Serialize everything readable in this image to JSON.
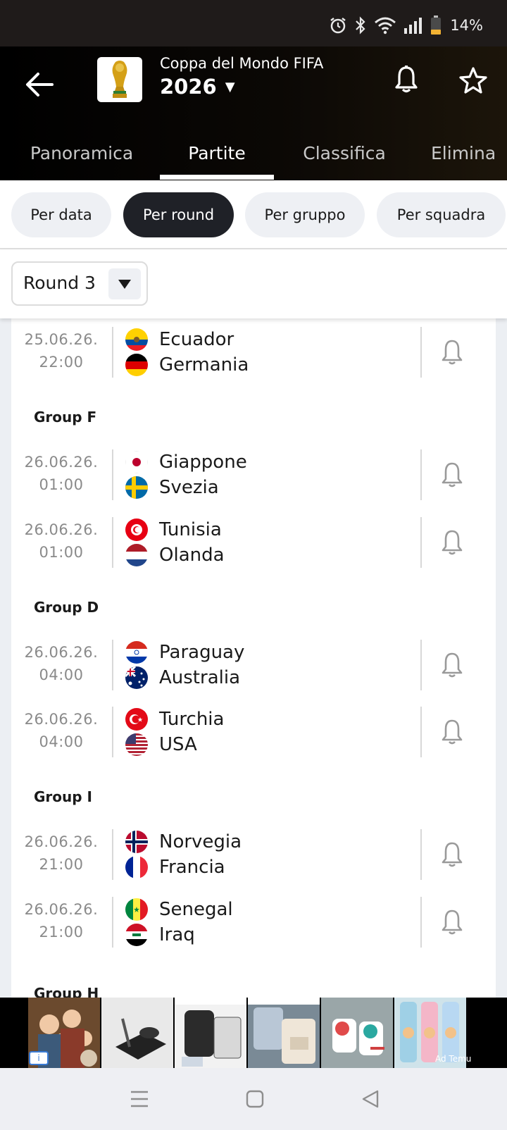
{
  "status_bar": {
    "battery_text": "14%",
    "icons": [
      "alarm-icon",
      "bluetooth-icon",
      "wifi-icon",
      "signal-icon",
      "battery-icon"
    ]
  },
  "header": {
    "competition": "Coppa del Mondo FIFA",
    "season": "2026",
    "season_caret": "▼",
    "icons": [
      "back-arrow-icon",
      "trophy-icon",
      "bell-icon",
      "star-icon"
    ]
  },
  "tabs": [
    {
      "label": "Panoramica",
      "active": false
    },
    {
      "label": "Partite",
      "active": true
    },
    {
      "label": "Classifica",
      "active": false
    },
    {
      "label": "Elimina",
      "active": false
    }
  ],
  "filters": [
    {
      "label": "Per data",
      "active": false
    },
    {
      "label": "Per round",
      "active": true
    },
    {
      "label": "Per gruppo",
      "active": false
    },
    {
      "label": "Per squadra",
      "active": false
    }
  ],
  "round_select": {
    "value": "Round 3",
    "arrow": "▼"
  },
  "matches": [
    {
      "date": "25.06.26.",
      "time": "22:00",
      "home": "Ecuador",
      "away": "Germania"
    },
    {
      "date": "26.06.26.",
      "time": "01:00",
      "home": "Giappone",
      "away": "Svezia"
    },
    {
      "date": "26.06.26.",
      "time": "01:00",
      "home": "Tunisia",
      "away": "Olanda"
    },
    {
      "date": "26.06.26.",
      "time": "04:00",
      "home": "Paraguay",
      "away": "Australia"
    },
    {
      "date": "26.06.26.",
      "time": "04:00",
      "home": "Turchia",
      "away": "USA"
    },
    {
      "date": "26.06.26.",
      "time": "21:00",
      "home": "Norvegia",
      "away": "Francia"
    },
    {
      "date": "26.06.26.",
      "time": "21:00",
      "home": "Senegal",
      "away": "Iraq"
    }
  ],
  "groups": [
    "Group F",
    "Group D",
    "Group I",
    "Group H"
  ],
  "ad": {
    "label": "Ad Temu",
    "info": "i"
  },
  "nav": {
    "icons": [
      "menu-icon",
      "home-square-icon",
      "back-triangle-icon"
    ]
  },
  "colors": {
    "header_bg": "#000000",
    "active_chip": "#1f2127",
    "chip_bg": "#eef0f4",
    "list_bg": "#eceff3"
  }
}
